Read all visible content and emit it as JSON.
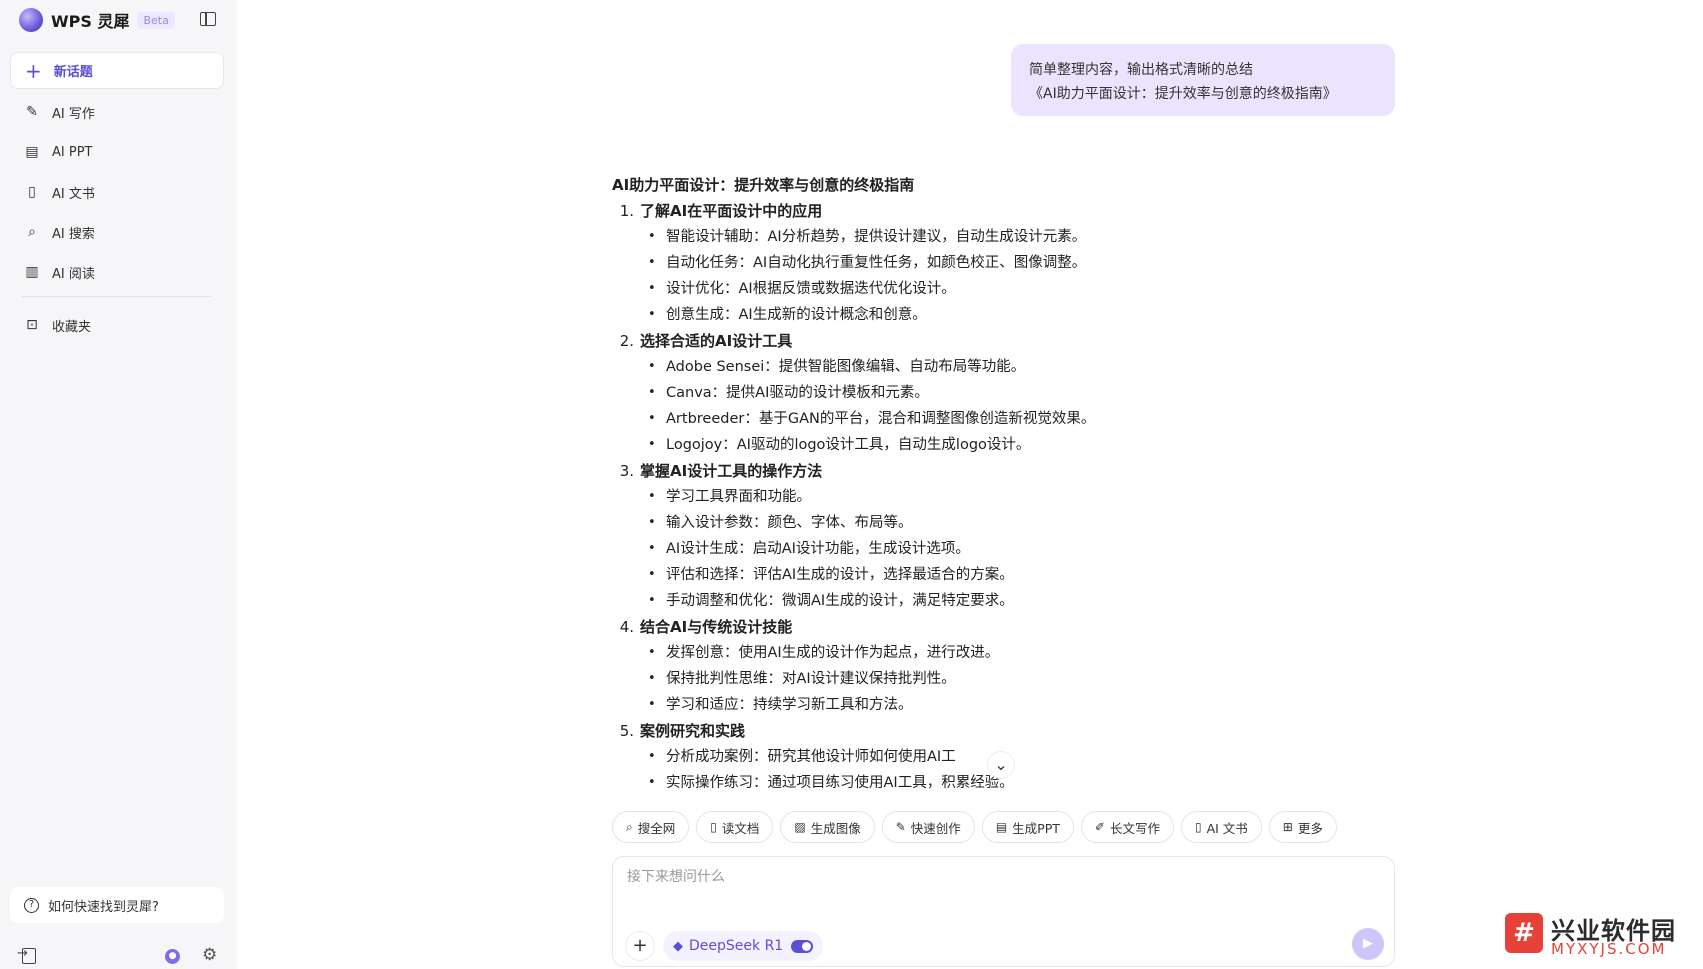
{
  "sidebar": {
    "brand_name": "WPS 灵犀",
    "brand_badge": "Beta",
    "new_topic": "新话题",
    "items": [
      {
        "label": "AI 写作",
        "icon": "pen-icon"
      },
      {
        "label": "AI PPT",
        "icon": "ppt-icon"
      },
      {
        "label": "AI 文书",
        "icon": "document-icon"
      },
      {
        "label": "AI 搜索",
        "icon": "search-icon"
      },
      {
        "label": "AI 阅读",
        "icon": "book-icon"
      }
    ],
    "favorites": "收藏夹",
    "help": "如何快速找到灵犀?"
  },
  "chat": {
    "user_message_line1": "简单整理内容，输出格式清晰的总结",
    "user_message_line2": "《AI助力平面设计：提升效率与创意的终极指南》",
    "answer_title": "AI助力平面设计：提升效率与创意的终极指南",
    "sections": [
      {
        "num": "1.",
        "title": "了解AI在平面设计中的应用",
        "bullets": [
          "智能设计辅助：AI分析趋势，提供设计建议，自动生成设计元素。",
          "自动化任务：AI自动化执行重复性任务，如颜色校正、图像调整。",
          "设计优化：AI根据反馈或数据迭代优化设计。",
          "创意生成：AI生成新的设计概念和创意。"
        ]
      },
      {
        "num": "2.",
        "title": "选择合适的AI设计工具",
        "bullets": [
          "Adobe Sensei：提供智能图像编辑、自动布局等功能。",
          "Canva：提供AI驱动的设计模板和元素。",
          "Artbreeder：基于GAN的平台，混合和调整图像创造新视觉效果。",
          "Logojoy：AI驱动的logo设计工具，自动生成logo设计。"
        ]
      },
      {
        "num": "3.",
        "title": "掌握AI设计工具的操作方法",
        "bullets": [
          "学习工具界面和功能。",
          "输入设计参数：颜色、字体、布局等。",
          "AI设计生成：启动AI设计功能，生成设计选项。",
          "评估和选择：评估AI生成的设计，选择最适合的方案。",
          "手动调整和优化：微调AI生成的设计，满足特定要求。"
        ]
      },
      {
        "num": "4.",
        "title": "结合AI与传统设计技能",
        "bullets": [
          "发挥创意：使用AI生成的设计作为起点，进行改进。",
          "保持批判性思维：对AI设计建议保持批判性。",
          "学习和适应：持续学习新工具和方法。"
        ]
      },
      {
        "num": "5.",
        "title": "案例研究和实践",
        "bullets": [
          "分析成功案例：研究其他设计师如何使用AI工",
          "实际操作练习：通过项目练习使用AI工具，积累经验。"
        ]
      }
    ]
  },
  "toolbar": [
    {
      "label": "搜全网",
      "icon": "search-icon"
    },
    {
      "label": "读文档",
      "icon": "read-doc-icon"
    },
    {
      "label": "生成图像",
      "icon": "image-icon"
    },
    {
      "label": "快速创作",
      "icon": "quick-write-icon"
    },
    {
      "label": "生成PPT",
      "icon": "ppt-icon"
    },
    {
      "label": "长文写作",
      "icon": "long-write-icon"
    },
    {
      "label": "AI 文书",
      "icon": "document-icon"
    },
    {
      "label": "更多",
      "icon": "grid-icon"
    }
  ],
  "composer": {
    "placeholder": "接下来想问什么",
    "model_name": "DeepSeek R1"
  },
  "watermark": {
    "title": "兴业软件园",
    "url": "MYXYJS.COM"
  },
  "colors": {
    "accent": "#5b4fd6",
    "user_bubble": "#ece4ff",
    "sidebar_bg": "#f6f6f8",
    "watermark_red": "#e8413a"
  }
}
